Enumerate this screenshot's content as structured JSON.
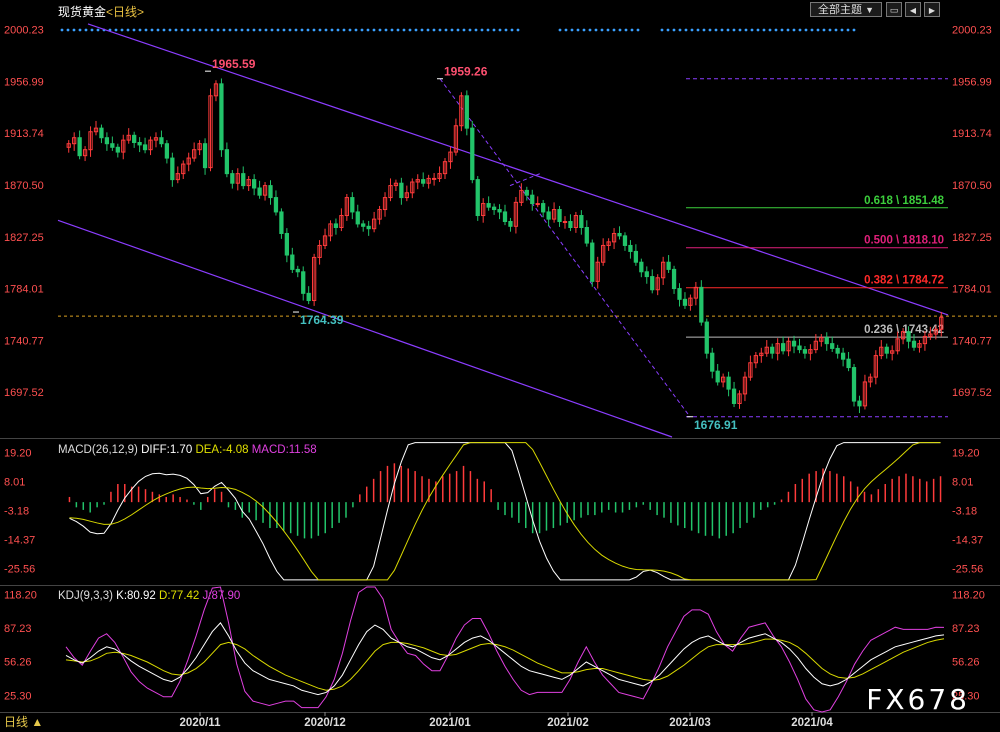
{
  "header": {
    "instrument": "现货黄金",
    "period": "<日线>",
    "theme_button": "全部主题",
    "theme_arrow": "▼"
  },
  "window_controls": {
    "minimize": "▭",
    "maximize": "◀",
    "close": "▶"
  },
  "watermark": "FX678",
  "period_status": "日线 ▲",
  "colors": {
    "up": "#ff3b3b",
    "down": "#22c46a",
    "channel": "#8b3dff",
    "fib_618": "#3ccf3c",
    "fib_500": "#e0207a",
    "fib_382": "#ff2a2a",
    "fib_236": "#bbbbbb",
    "current_price_line": "#d9a020",
    "axis_text": "#ff5050",
    "kdj_k": "#ffffff",
    "kdj_d": "#d8d800",
    "kdj_j": "#e040e0",
    "macd_diff": "#ffffff",
    "macd_dea": "#d8d800"
  },
  "chart_data": [
    {
      "type": "candlestick",
      "title": "现货黄金<日线>",
      "ylim": [
        1660,
        2010
      ],
      "y_ticks": [
        "2000.23",
        "1956.99",
        "1913.74",
        "1870.50",
        "1827.25",
        "1784.01",
        "1740.77",
        "1697.52"
      ],
      "x_ticks": [
        "2020/11",
        "2020/12",
        "2021/01",
        "2021/02",
        "2021/03",
        "2021/04"
      ],
      "annotations": [
        {
          "label": "1965.59",
          "value": 1965.59,
          "kind": "high"
        },
        {
          "label": "1764.39",
          "value": 1764.39,
          "kind": "low"
        },
        {
          "label": "1959.26",
          "value": 1959.26,
          "kind": "high"
        },
        {
          "label": "1676.91",
          "value": 1676.91,
          "kind": "low"
        }
      ],
      "fibonacci": [
        {
          "label": "0.618 \\ 1851.48",
          "value": 1851.48
        },
        {
          "label": "0.500 \\ 1818.10",
          "value": 1818.1
        },
        {
          "label": "0.382 \\ 1784.72",
          "value": 1784.72
        },
        {
          "label": "0.236 \\ 1743.42",
          "value": 1743.42
        }
      ],
      "close_series": [
        1905,
        1910,
        1895,
        1900,
        1915,
        1918,
        1910,
        1905,
        1902,
        1898,
        1908,
        1912,
        1906,
        1904,
        1900,
        1908,
        1910,
        1905,
        1893,
        1875,
        1880,
        1888,
        1893,
        1900,
        1905,
        1885,
        1945,
        1955,
        1900,
        1880,
        1872,
        1880,
        1870,
        1875,
        1868,
        1862,
        1870,
        1860,
        1848,
        1830,
        1812,
        1800,
        1798,
        1780,
        1774,
        1810,
        1820,
        1828,
        1838,
        1835,
        1845,
        1860,
        1848,
        1838,
        1836,
        1834,
        1842,
        1850,
        1860,
        1870,
        1872,
        1860,
        1864,
        1873,
        1875,
        1872,
        1876,
        1876,
        1880,
        1890,
        1898,
        1920,
        1945,
        1918,
        1875,
        1845,
        1855,
        1852,
        1850,
        1848,
        1840,
        1836,
        1856,
        1866,
        1862,
        1855,
        1855,
        1848,
        1842,
        1850,
        1840,
        1840,
        1835,
        1845,
        1835,
        1822,
        1790,
        1806,
        1820,
        1823,
        1830,
        1828,
        1820,
        1815,
        1806,
        1798,
        1794,
        1783,
        1793,
        1806,
        1800,
        1784,
        1775,
        1770,
        1776,
        1785,
        1756,
        1730,
        1715,
        1706,
        1710,
        1700,
        1688,
        1696,
        1710,
        1722,
        1728,
        1730,
        1735,
        1730,
        1738,
        1732,
        1740,
        1736,
        1733,
        1730,
        1733,
        1740,
        1743,
        1738,
        1734,
        1730,
        1725,
        1718,
        1690,
        1686,
        1706,
        1710,
        1728,
        1735,
        1730,
        1732,
        1742,
        1748,
        1740,
        1735,
        1738,
        1744,
        1746,
        1750,
        1760
      ],
      "last_price": 1761
    },
    {
      "type": "macd",
      "title": "MACD(26,12,9)",
      "diff": 1.7,
      "dea": -4.08,
      "macd": 11.58,
      "diff_label": "DIFF:1.70",
      "dea_label": "DEA:-4.08",
      "macd_label": "MACD:11.58",
      "ylim": [
        -32,
        24
      ],
      "y_ticks": [
        "19.20",
        "8.01",
        "-3.18",
        "-14.37",
        "-25.56"
      ],
      "histogram": [
        2,
        -2,
        -3,
        -4,
        -2,
        -1,
        4,
        7,
        7,
        6,
        6,
        5,
        4,
        3,
        2,
        3,
        2,
        1,
        -1,
        -3,
        2,
        5,
        4,
        -2,
        -3,
        -6,
        -4,
        -7,
        -8,
        -10,
        -10,
        -11,
        -12,
        -13,
        -14,
        -14,
        -13,
        -12,
        -10,
        -8,
        -6,
        -2,
        3,
        6,
        9,
        12,
        14,
        15,
        14,
        13,
        12,
        10,
        9,
        8,
        10,
        11,
        12,
        14,
        12,
        9,
        8,
        5,
        -3,
        -5,
        -6,
        -8,
        -10,
        -12,
        -12,
        -11,
        -10,
        -9,
        -8,
        -7,
        -6,
        -5,
        -5,
        -4,
        -3,
        -4,
        -4,
        -3,
        -2,
        -1,
        -3,
        -5,
        -6,
        -8,
        -9,
        -10,
        -11,
        -12,
        -13,
        -13,
        -14,
        -13,
        -12,
        -10,
        -8,
        -6,
        -3,
        -2,
        -1,
        1,
        4,
        7,
        9,
        11,
        12,
        13,
        12,
        11,
        10,
        8,
        6,
        4,
        3,
        5,
        7,
        9,
        10,
        11,
        10,
        9,
        8,
        9,
        10
      ]
    },
    {
      "type": "kdj",
      "title": "KDJ(9,3,3)",
      "k": 80.92,
      "d": 77.42,
      "j": 87.9,
      "k_label": "K:80.92",
      "d_label": "D:77.42",
      "j_label": "J:87.90",
      "ylim": [
        10,
        125
      ],
      "y_ticks": [
        "118.20",
        "87.23",
        "56.26",
        "25.30"
      ],
      "k_series": [
        62,
        58,
        55,
        60,
        66,
        70,
        68,
        63,
        57,
        52,
        48,
        44,
        40,
        38,
        42,
        50,
        60,
        72,
        84,
        92,
        80,
        66,
        55,
        48,
        44,
        40,
        38,
        36,
        34,
        30,
        28,
        26,
        28,
        34,
        44,
        58,
        72,
        84,
        90,
        86,
        78,
        74,
        70,
        68,
        64,
        60,
        58,
        62,
        68,
        74,
        78,
        80,
        76,
        70,
        64,
        58,
        52,
        48,
        46,
        44,
        42,
        40,
        44,
        50,
        56,
        52,
        48,
        44,
        40,
        38,
        36,
        34,
        38,
        44,
        52,
        60,
        68,
        74,
        78,
        80,
        76,
        72,
        70,
        74,
        78,
        80,
        82,
        78,
        74,
        68,
        60,
        50,
        42,
        36,
        34,
        36,
        40,
        46,
        52,
        58,
        62,
        66,
        70,
        72,
        74,
        76,
        78,
        80,
        81
      ],
      "d_series": [
        58,
        57,
        56,
        57,
        60,
        64,
        65,
        64,
        62,
        59,
        56,
        52,
        48,
        45,
        44,
        46,
        50,
        56,
        64,
        72,
        74,
        72,
        68,
        62,
        57,
        52,
        48,
        44,
        41,
        38,
        35,
        32,
        30,
        31,
        34,
        40,
        48,
        57,
        66,
        72,
        74,
        74,
        73,
        71,
        69,
        66,
        63,
        62,
        63,
        66,
        69,
        72,
        73,
        72,
        70,
        67,
        63,
        59,
        55,
        52,
        49,
        46,
        46,
        47,
        49,
        50,
        50,
        48,
        46,
        44,
        42,
        40,
        39,
        40,
        43,
        48,
        53,
        59,
        65,
        70,
        72,
        72,
        72,
        72,
        73,
        75,
        77,
        77,
        76,
        74,
        70,
        64,
        57,
        50,
        45,
        42,
        41,
        42,
        45,
        49,
        53,
        57,
        61,
        65,
        68,
        71,
        74,
        76,
        77.42
      ],
      "j_series": [
        70,
        60,
        53,
        66,
        78,
        82,
        74,
        61,
        47,
        38,
        32,
        28,
        24,
        24,
        38,
        58,
        80,
        104,
        124,
        132,
        92,
        54,
        29,
        20,
        18,
        16,
        18,
        20,
        20,
        14,
        14,
        14,
        24,
        40,
        64,
        94,
        120,
        138,
        138,
        114,
        86,
        74,
        64,
        62,
        54,
        48,
        48,
        62,
        78,
        90,
        96,
        96,
        82,
        66,
        52,
        40,
        30,
        26,
        28,
        28,
        28,
        28,
        40,
        56,
        70,
        56,
        44,
        36,
        28,
        26,
        24,
        22,
        36,
        52,
        70,
        84,
        98,
        104,
        104,
        100,
        84,
        72,
        66,
        78,
        88,
        90,
        92,
        80,
        70,
        56,
        40,
        22,
        12,
        8,
        12,
        24,
        38,
        54,
        66,
        76,
        80,
        84,
        88,
        86,
        86,
        86,
        86,
        88,
        87.9
      ]
    }
  ]
}
